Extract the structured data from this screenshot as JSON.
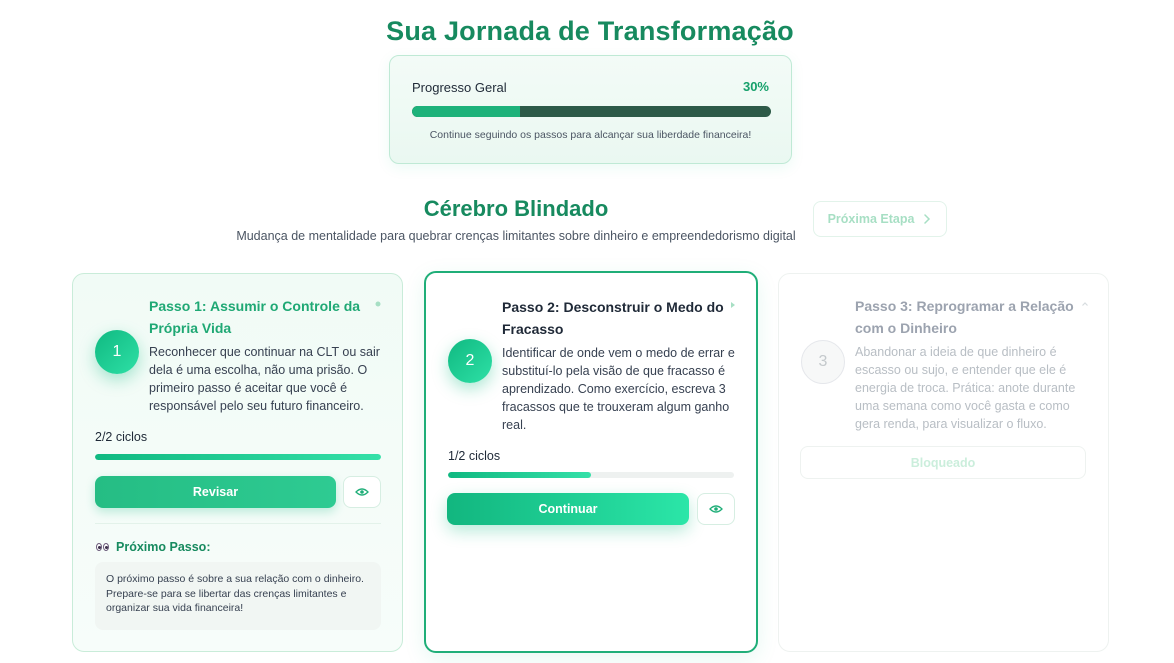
{
  "header": {
    "title": "Sua Jornada de Transformação"
  },
  "progress": {
    "label": "Progresso Geral",
    "percent_text": "30%",
    "percent": 30,
    "note": "Continue seguindo os passos para alcançar sua liberdade financeira!"
  },
  "section": {
    "title": "Cérebro Blindado",
    "subtitle": "Mudança de mentalidade para quebrar crenças limitantes sobre dinheiro e empreendedorismo digital",
    "next_stage_label": "Próxima Etapa"
  },
  "steps": [
    {
      "number": "1",
      "title": "Passo 1: Assumir o Controle da Própria Vida",
      "description": "Reconhecer que continuar na CLT ou sair dela é uma escolha, não uma prisão. O primeiro passo é aceitar que você é responsável pelo seu futuro financeiro.",
      "cycles_text": "2/2 ciclos",
      "cycles_fraction": 1.0,
      "button_label": "Revisar",
      "next_step_heading": "Próximo Passo:",
      "next_step_text": "O próximo passo é sobre a sua relação com o dinheiro. Prepare-se para se libertar das crenças limitantes e organizar sua vida financeira!"
    },
    {
      "number": "2",
      "title": "Passo 2: Desconstruir o Medo do Fracasso",
      "description": "Identificar de onde vem o medo de errar e substituí-lo pela visão de que fracasso é aprendizado. Como exercício, escreva 3 fracassos que te trouxeram algum ganho real.",
      "cycles_text": "1/2 ciclos",
      "cycles_fraction": 0.5,
      "button_label": "Continuar"
    },
    {
      "number": "3",
      "title": "Passo 3: Reprogramar a Relação com o Dinheiro",
      "description": "Abandonar a ideia de que dinheiro é escasso ou sujo, e entender que ele é energia de troca. Prática: anote durante uma semana como você gasta e como gera renda, para visualizar o fluxo.",
      "button_label": "Bloqueado"
    }
  ],
  "colors": {
    "brand": "#178a5f",
    "accent": "#10b981",
    "progress_track": "#2d5a48",
    "locked_text": "#c4c9cc"
  },
  "icons": {
    "next_stage": "chevron-right-icon",
    "view": "eye-icon",
    "next_step": "eyes-icon",
    "step1_corner": "dot-icon",
    "step2_corner": "play-icon",
    "step3_corner": "chevron-up-icon"
  }
}
